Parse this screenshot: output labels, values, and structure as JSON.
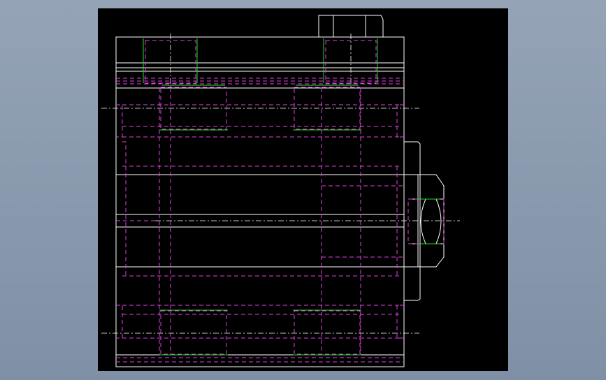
{
  "viewer": {
    "background_top": "#94a3b6",
    "background_bottom": "#7f90a6",
    "canvas_color": "#000000"
  },
  "drawing": {
    "line_colors": {
      "visible": "#ffffff",
      "hidden": "#e040e0",
      "thread": "#22dd22",
      "center": "#ffffff"
    }
  }
}
